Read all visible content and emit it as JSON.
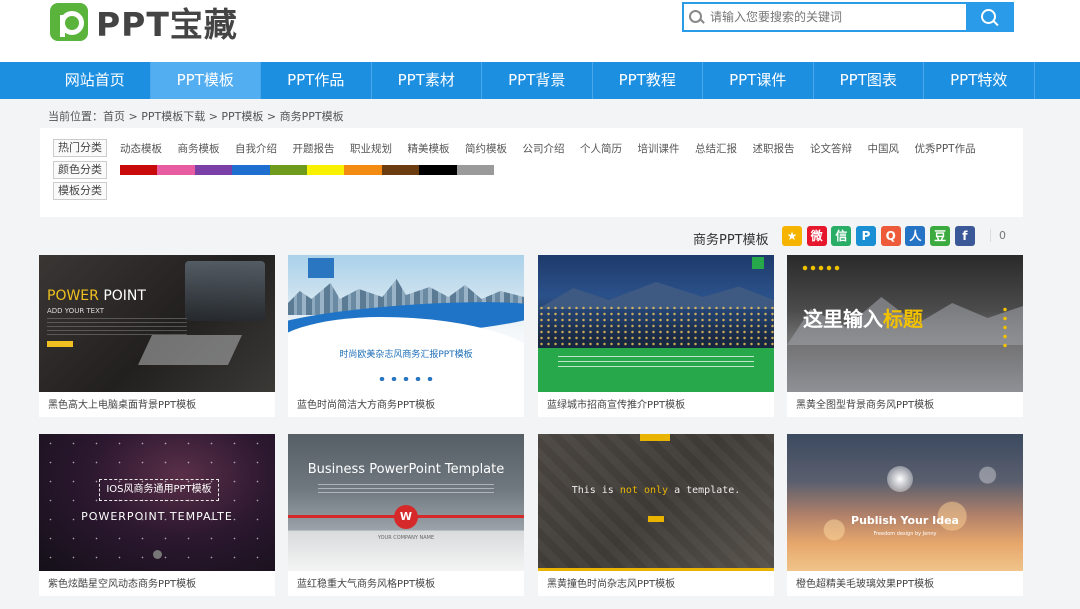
{
  "logo": {
    "text": "PPT宝藏"
  },
  "search": {
    "placeholder": "请输入您要搜索的关键词"
  },
  "nav": [
    {
      "label": "网站首页",
      "active": false
    },
    {
      "label": "PPT模板",
      "active": true
    },
    {
      "label": "PPT作品",
      "active": false
    },
    {
      "label": "PPT素材",
      "active": false
    },
    {
      "label": "PPT背景",
      "active": false
    },
    {
      "label": "PPT教程",
      "active": false
    },
    {
      "label": "PPT课件",
      "active": false
    },
    {
      "label": "PPT图表",
      "active": false
    },
    {
      "label": "PPT特效",
      "active": false
    }
  ],
  "breadcrumb": "当前位置：首页 > PPT模板下载 > PPT模板 > 商务PPT模板",
  "filters": {
    "hot_label": "热门分类",
    "hot_items": [
      "动态模板",
      "商务模板",
      "自我介绍",
      "开题报告",
      "职业规划",
      "精美模板",
      "简约模板",
      "公司介绍",
      "个人简历",
      "培训课件",
      "总结汇报",
      "述职报告",
      "论文答辩",
      "中国风",
      "优秀PPT作品"
    ],
    "color_label": "颜色分类",
    "colors": [
      "#c90a0a",
      "#e85ca1",
      "#7b3fa8",
      "#1f6fd0",
      "#6f9b1c",
      "#f8f200",
      "#f38b12",
      "#6b3c10",
      "#000000",
      "#9a9a9a"
    ],
    "template_label": "模板分类"
  },
  "section": {
    "title": "商务PPT模板",
    "share_count": "0",
    "share_icons": [
      {
        "name": "favorite-icon",
        "color": "#f5b400",
        "glyph": "★"
      },
      {
        "name": "weibo-icon",
        "color": "#e6162d",
        "glyph": "微"
      },
      {
        "name": "wechat-icon",
        "color": "#2aae67",
        "glyph": "信"
      },
      {
        "name": "pinyin-icon",
        "color": "#1a8fd3",
        "glyph": "P"
      },
      {
        "name": "qq-icon",
        "color": "#ee5b3a",
        "glyph": "Q"
      },
      {
        "name": "renren-icon",
        "color": "#2473c5",
        "glyph": "人"
      },
      {
        "name": "douban-icon",
        "color": "#3bab3f",
        "glyph": "豆"
      },
      {
        "name": "facebook-icon",
        "color": "#3b5998",
        "glyph": "f"
      }
    ]
  },
  "cards": [
    {
      "caption": "黑色高大上电脑桌面背景PPT模板",
      "thumb": {
        "title_a": "POWER",
        "title_b": "POINT",
        "sub": "ADD YOUR TEXT"
      }
    },
    {
      "caption": "蓝色时尚简洁大方商务PPT模板",
      "thumb": {
        "title": "时尚欧美杂志风商务汇报PPT模板"
      }
    },
    {
      "caption": "蓝绿城市招商宣传推介PPT模板",
      "thumb": {}
    },
    {
      "caption": "黑黄全图型背景商务风PPT模板",
      "thumb": {
        "title_a": "这里输入",
        "title_b": "标题"
      }
    },
    {
      "caption": "紫色炫酷星空风动态商务PPT模板",
      "thumb": {
        "box": "IOS风商务通用PPT模板",
        "title": "POWERPOINT TEMPALTE"
      }
    },
    {
      "caption": "蓝红稳重大气商务风格PPT模板",
      "thumb": {
        "title": "Business PowerPoint Template",
        "badge": "W",
        "foot": "YOUR COMPANY NAME"
      }
    },
    {
      "caption": "黑黄撞色时尚杂志风PPT模板",
      "thumb": {
        "title_a": "This is",
        "title_b": "not only",
        "title_c": "a template."
      }
    },
    {
      "caption": "橙色超精美毛玻璃效果PPT模板",
      "thumb": {
        "title": "Publish Your Idea",
        "sub": "Freedom design by Jenny"
      }
    }
  ]
}
